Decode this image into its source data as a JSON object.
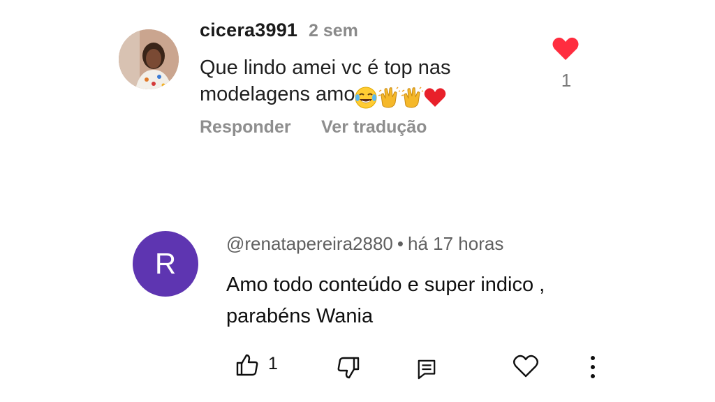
{
  "comment1": {
    "username": "cicera3991",
    "time": "2 sem",
    "text_line1": "Que lindo amei vc é top  nas",
    "text_line2": "modelagens amo",
    "emojis": [
      "face-with-tears-of-joy-emoji",
      "clapping-hands-emoji",
      "clapping-hands-emoji",
      "red-heart-emoji"
    ],
    "reply_label": "Responder",
    "translate_label": "Ver tradução",
    "heart_count": "1",
    "heart_color": "#ff2d3f"
  },
  "comment2": {
    "avatar_letter": "R",
    "avatar_color": "#5e35b1",
    "handle": "@renatapereira2880",
    "separator": "•",
    "time": "há 17 horas",
    "text_line1": "Amo todo conteúdo e super indico ,",
    "text_line2": "parabéns Wania",
    "like_count": "1"
  }
}
